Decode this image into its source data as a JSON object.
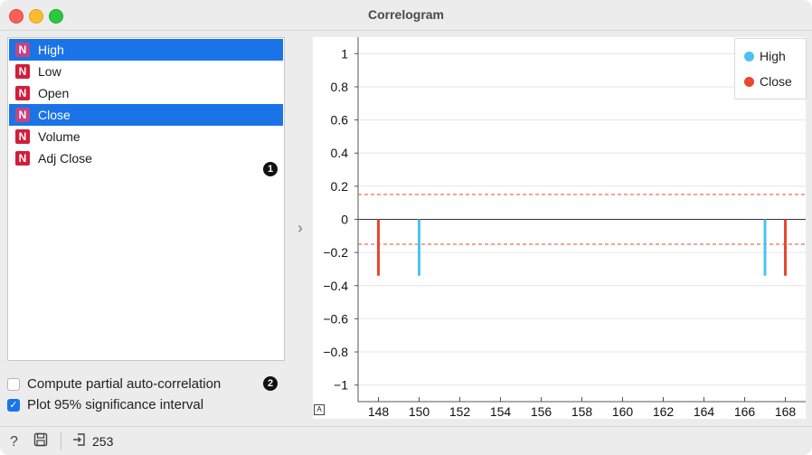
{
  "window": {
    "title": "Correlogram"
  },
  "variables": [
    {
      "label": "High",
      "type_badge": "N",
      "selected": true
    },
    {
      "label": "Low",
      "type_badge": "N",
      "selected": false
    },
    {
      "label": "Open",
      "type_badge": "N",
      "selected": false
    },
    {
      "label": "Close",
      "type_badge": "N",
      "selected": true
    },
    {
      "label": "Volume",
      "type_badge": "N",
      "selected": false
    },
    {
      "label": "Adj Close",
      "type_badge": "N",
      "selected": false
    }
  ],
  "markers": {
    "m1": "1",
    "m2": "2"
  },
  "options": {
    "partial": {
      "label": "Compute partial auto-correlation",
      "checked": false
    },
    "significance": {
      "label": "Plot 95% significance interval",
      "checked": true
    }
  },
  "colors": {
    "high": "#4fc1f0",
    "close": "#e8482c",
    "selection": "#1a74e8",
    "threshold": "#e8482c"
  },
  "chart_data": {
    "type": "bar",
    "title": "",
    "xlabel": "",
    "ylabel": "",
    "xlim": [
      147,
      169
    ],
    "ylim": [
      -1.1,
      1.1
    ],
    "x_ticks": [
      148,
      150,
      152,
      154,
      156,
      158,
      160,
      162,
      164,
      166,
      168
    ],
    "y_ticks": [
      1,
      0.8,
      0.6,
      0.4,
      0.2,
      0,
      -0.2,
      -0.4,
      -0.6,
      -0.8,
      -1
    ],
    "y_tick_labels": [
      "1",
      "0.8",
      "0.6",
      "0.4",
      "0.2",
      "0",
      "−0.2",
      "−0.4",
      "−0.6",
      "−0.8",
      "−1"
    ],
    "significance_interval": [
      -0.15,
      0.15
    ],
    "grid": true,
    "legend_position": "top-right",
    "series": [
      {
        "name": "High",
        "color": "#4fc1f0",
        "points": [
          {
            "x": 150,
            "y": -0.34
          },
          {
            "x": 167,
            "y": -0.34
          }
        ]
      },
      {
        "name": "Close",
        "color": "#e8482c",
        "points": [
          {
            "x": 148,
            "y": -0.34
          },
          {
            "x": 168,
            "y": -0.34
          }
        ]
      }
    ]
  },
  "status": {
    "count": "253",
    "help_icon": "help-icon",
    "save_icon": "save-icon",
    "output_icon": "output-icon"
  },
  "a_badge": "A"
}
